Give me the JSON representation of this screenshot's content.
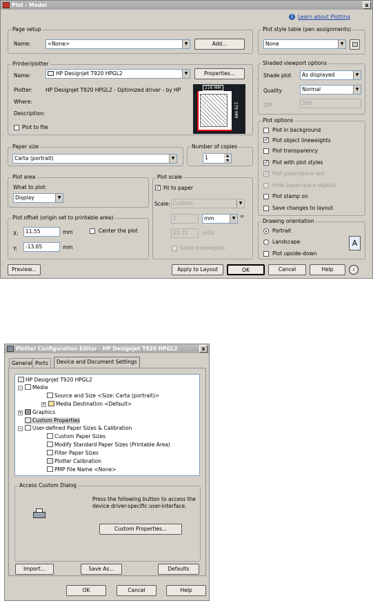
{
  "plot_dialog": {
    "title": "Plot - Model",
    "close_glyph": "x",
    "help_link": "Learn about Plotting",
    "page_setup": {
      "group_label": "Page setup",
      "name_label": "Name:",
      "name_value": "<None>",
      "add_button": "Add..."
    },
    "printer": {
      "group_label": "Printer/plotter",
      "name_label": "Name:",
      "name_value": "HP Designjet T920 HPGL2",
      "properties_button": "Properties...",
      "plotter_label": "Plotter:",
      "plotter_value": "HP Designjet T920 HPGL2 - Optimized driver - by HP",
      "where_label": "Where:",
      "description_label": "Description:",
      "plot_to_file": "Plot to file",
      "preview_width": "216 MM",
      "preview_height": "279 MM"
    },
    "paper_size": {
      "group_label": "Paper size",
      "value": "Carta (portrait)"
    },
    "copies": {
      "group_label": "Number of copies",
      "value": "1"
    },
    "plot_area": {
      "group_label": "Plot area",
      "what_label": "What to plot:",
      "value": "Display"
    },
    "plot_offset": {
      "group_label": "Plot offset (origin set to printable area)",
      "x_label": "X:",
      "x_value": "11.55",
      "y_label": "Y:",
      "y_value": "-13.65",
      "unit": "mm",
      "center": "Center the plot"
    },
    "plot_scale": {
      "group_label": "Plot scale",
      "fit": "Fit to paper",
      "scale_label": "Scale:",
      "scale_value": "Custom",
      "num_value": "1",
      "unit_value": "mm",
      "eq": "=",
      "units_value": "22.71",
      "units_label": "units",
      "scale_lineweights": "Scale lineweights"
    },
    "style_table": {
      "group_label": "Plot style table (pen assignments)",
      "value": "None"
    },
    "shaded": {
      "group_label": "Shaded viewport options",
      "shade_label": "Shade plot",
      "shade_value": "As displayed",
      "quality_label": "Quality",
      "quality_value": "Normal",
      "dpi_label": "DPI",
      "dpi_value": "300"
    },
    "plot_options": {
      "group_label": "Plot options",
      "items": [
        {
          "label": "Plot in background",
          "checked": "",
          "disabled": false
        },
        {
          "label": "Plot object lineweights",
          "checked": "✓",
          "disabled": false
        },
        {
          "label": "Plot transparency",
          "checked": "",
          "disabled": false
        },
        {
          "label": "Plot with plot styles",
          "checked": "✓",
          "disabled": false
        },
        {
          "label": "Plot paperspace last",
          "checked": "✓",
          "disabled": true
        },
        {
          "label": "Hide paperspace objects",
          "checked": "",
          "disabled": true
        },
        {
          "label": "Plot stamp on",
          "checked": "",
          "disabled": false
        },
        {
          "label": "Save changes to layout",
          "checked": "",
          "disabled": false
        }
      ]
    },
    "orientation": {
      "group_label": "Drawing orientation",
      "portrait": "Portrait",
      "landscape": "Landscape",
      "upside": "Plot upside-down",
      "icon_letter": "A"
    },
    "buttons": {
      "preview": "Preview...",
      "apply": "Apply to Layout",
      "ok": "OK",
      "cancel": "Cancel",
      "help": "Help"
    }
  },
  "config_dialog": {
    "title": "Plotter Configuration Editor - HP Designjet T920 HPGL2",
    "close_glyph": "x",
    "tabs": [
      "General",
      "Ports",
      "Device and Document Settings"
    ],
    "tree": [
      {
        "label": "HP Designjet T920 HPGL2"
      },
      {
        "label": "Media"
      },
      {
        "label": "Source and Size <Size: Carta (portrait)>"
      },
      {
        "label": "Media Destination <Default>"
      },
      {
        "label": "Graphics"
      },
      {
        "label": "Custom Properties"
      },
      {
        "label": "User-defined Paper Sizes & Calibration"
      },
      {
        "label": "Custom Paper Sizes"
      },
      {
        "label": "Modify Standard Paper Sizes (Printable Area)"
      },
      {
        "label": "Filter Paper Sizes"
      },
      {
        "label": "Plotter Calibration"
      },
      {
        "label": "PMP File Name <None>"
      }
    ],
    "access": {
      "group_label": "Access Custom Dialog",
      "text": "Press the following button to access the device driver-specific user-interface.",
      "button": "Custom Properties..."
    },
    "buttons": {
      "import": "Import...",
      "save_as": "Save As...",
      "defaults": "Defaults",
      "ok": "OK",
      "cancel": "Cancel",
      "help": "Help"
    }
  }
}
